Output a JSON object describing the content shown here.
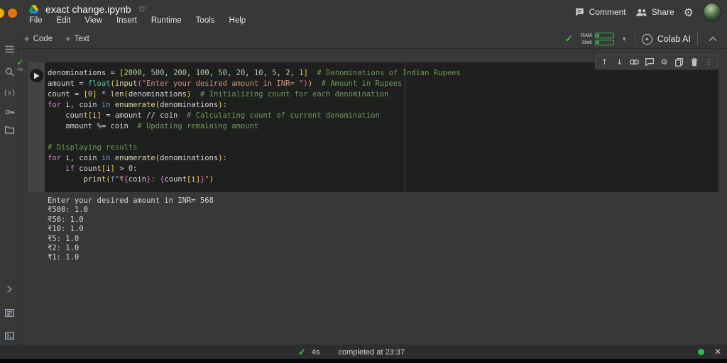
{
  "brand": {
    "logo_orange": "#e8710a",
    "logo_yellow": "#f9ab00",
    "accent_green": "#3fba54"
  },
  "palette": {
    "plain": "#d4d4d4",
    "keyword": "#c586c0",
    "keyword2": "#569cd6",
    "function": "#dcdcaa",
    "type": "#4ec9b0",
    "number": "#b5cea8",
    "string": "#ce9178",
    "comment": "#6a9955",
    "bracket1": "#ffd700",
    "bracket2": "#da70d6"
  },
  "icons": {
    "star": "☆",
    "plus": "+",
    "caret_down": "▾",
    "gear": "⚙",
    "more_vert": "⋮",
    "arrow_up": "↑",
    "arrow_down": "↓",
    "close": "✕",
    "check": "✓",
    "sparkle": "✦",
    "variables": "{x}",
    "status_dot": "●"
  },
  "header": {
    "title": "exact change.ipynb",
    "menus": [
      "File",
      "Edit",
      "View",
      "Insert",
      "Runtime",
      "Tools",
      "Help"
    ],
    "comment_label": "Comment",
    "share_label": "Share"
  },
  "toolbar": {
    "add_code": "Code",
    "add_text": "Text",
    "ram_label": "RAM",
    "disk_label": "Disk",
    "colab_ai_label": "Colab AI"
  },
  "sidebar": {
    "icons": [
      "table-of-contents",
      "search",
      "variables",
      "secrets",
      "files",
      "code-snippets",
      "command-palette",
      "terminal"
    ]
  },
  "cell": {
    "exec_duration": "4s",
    "toolbar_icons": [
      "move-up",
      "move-down",
      "link",
      "comment",
      "cell-settings",
      "copy",
      "delete",
      "more"
    ],
    "code_lines": [
      [
        [
          "denominations = ",
          "plain"
        ],
        [
          "[",
          "bracket1"
        ],
        [
          "2000",
          "number"
        ],
        [
          ", ",
          "plain"
        ],
        [
          "500",
          "number"
        ],
        [
          ", ",
          "plain"
        ],
        [
          "200",
          "number"
        ],
        [
          ", ",
          "plain"
        ],
        [
          "100",
          "number"
        ],
        [
          ", ",
          "plain"
        ],
        [
          "50",
          "number"
        ],
        [
          ", ",
          "plain"
        ],
        [
          "20",
          "number"
        ],
        [
          ", ",
          "plain"
        ],
        [
          "10",
          "number"
        ],
        [
          ", ",
          "plain"
        ],
        [
          "5",
          "number"
        ],
        [
          ", ",
          "plain"
        ],
        [
          "2",
          "number"
        ],
        [
          ", ",
          "plain"
        ],
        [
          "1",
          "number"
        ],
        [
          "]",
          "bracket1"
        ],
        [
          "  ",
          "plain"
        ],
        [
          "# Denominations of Indian Rupees",
          "comment"
        ]
      ],
      [
        [
          "amount = ",
          "plain"
        ],
        [
          "float",
          "type"
        ],
        [
          "(",
          "bracket1"
        ],
        [
          "input",
          "function"
        ],
        [
          "(",
          "bracket2"
        ],
        [
          "\"Enter your desired amount in INR= \"",
          "string"
        ],
        [
          ")",
          "bracket2"
        ],
        [
          ")",
          "bracket1"
        ],
        [
          "  ",
          "plain"
        ],
        [
          "# Amount in Rupees",
          "comment"
        ]
      ],
      [
        [
          "count = ",
          "plain"
        ],
        [
          "[",
          "bracket1"
        ],
        [
          "0",
          "number"
        ],
        [
          "]",
          "bracket1"
        ],
        [
          " * ",
          "plain"
        ],
        [
          "len",
          "function"
        ],
        [
          "(",
          "bracket1"
        ],
        [
          "denominations",
          "plain"
        ],
        [
          ")",
          "bracket1"
        ],
        [
          "  ",
          "plain"
        ],
        [
          "# Initializing count for each denomination",
          "comment"
        ]
      ],
      [
        [
          "for",
          "keyword"
        ],
        [
          " i, coin ",
          "plain"
        ],
        [
          "in",
          "keyword2"
        ],
        [
          " ",
          "plain"
        ],
        [
          "enumerate",
          "function"
        ],
        [
          "(",
          "bracket1"
        ],
        [
          "denominations",
          "plain"
        ],
        [
          ")",
          "bracket1"
        ],
        [
          ":",
          "plain"
        ]
      ],
      [
        [
          "    count",
          "plain"
        ],
        [
          "[",
          "bracket1"
        ],
        [
          "i",
          "plain"
        ],
        [
          "]",
          "bracket1"
        ],
        [
          " = amount // coin  ",
          "plain"
        ],
        [
          "# Calculating count of current denomination",
          "comment"
        ]
      ],
      [
        [
          "    amount %= coin  ",
          "plain"
        ],
        [
          "# Updating remaining amount",
          "comment"
        ]
      ],
      [],
      [
        [
          "# Displaying results",
          "comment"
        ]
      ],
      [
        [
          "for",
          "keyword"
        ],
        [
          " i, coin ",
          "plain"
        ],
        [
          "in",
          "keyword2"
        ],
        [
          " ",
          "plain"
        ],
        [
          "enumerate",
          "function"
        ],
        [
          "(",
          "bracket1"
        ],
        [
          "denominations",
          "plain"
        ],
        [
          ")",
          "bracket1"
        ],
        [
          ":",
          "plain"
        ]
      ],
      [
        [
          "    ",
          "plain"
        ],
        [
          "if",
          "keyword"
        ],
        [
          " count",
          "plain"
        ],
        [
          "[",
          "bracket1"
        ],
        [
          "i",
          "plain"
        ],
        [
          "]",
          "bracket1"
        ],
        [
          " > ",
          "plain"
        ],
        [
          "0",
          "number"
        ],
        [
          ":",
          "plain"
        ]
      ],
      [
        [
          "        ",
          "plain"
        ],
        [
          "print",
          "function"
        ],
        [
          "(",
          "bracket1"
        ],
        [
          "f",
          "keyword2"
        ],
        [
          "\"₹",
          "string"
        ],
        [
          "{",
          "bracket2"
        ],
        [
          "coin",
          "plain"
        ],
        [
          "}",
          "bracket2"
        ],
        [
          ": ",
          "string"
        ],
        [
          "{",
          "bracket2"
        ],
        [
          "count",
          "plain"
        ],
        [
          "[",
          "bracket1"
        ],
        [
          "i",
          "plain"
        ],
        [
          "]",
          "bracket1"
        ],
        [
          "}",
          "bracket2"
        ],
        [
          "\"",
          "string"
        ],
        [
          ")",
          "bracket1"
        ]
      ]
    ],
    "output_lines": [
      "Enter your desired amount in INR= 568",
      "₹500: 1.0",
      "₹50: 1.0",
      "₹10: 1.0",
      "₹5: 1.0",
      "₹2: 1.0",
      "₹1: 1.0"
    ]
  },
  "statusbar": {
    "duration": "4s",
    "message": "completed at 23:37"
  }
}
